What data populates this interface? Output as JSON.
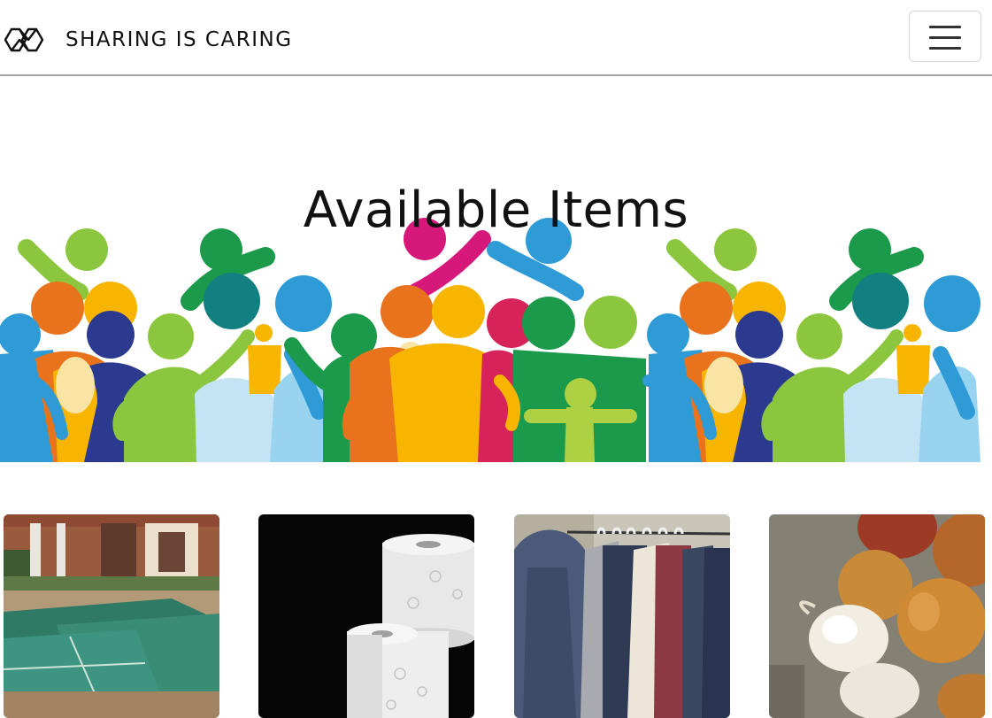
{
  "navbar": {
    "brand_text": "SHARING IS CARING",
    "logo_icon": "interlocking-diamonds-icon",
    "menu_icon": "hamburger-menu-icon"
  },
  "hero": {
    "title": "Available Items",
    "banner": "colorful-people-crowd-illustration"
  },
  "items": [
    {
      "image": "outdoor-ping-pong-tables-photo"
    },
    {
      "image": "toilet-paper-rolls-photo"
    },
    {
      "image": "clothes-on-rack-photo"
    },
    {
      "image": "onions-and-garlic-photo"
    }
  ],
  "colors": {
    "accent_green": "#8cc63f",
    "accent_orange": "#e8731c",
    "accent_blue": "#2e9bd6",
    "accent_magenta": "#d6187a",
    "accent_yellow": "#f7b500"
  }
}
